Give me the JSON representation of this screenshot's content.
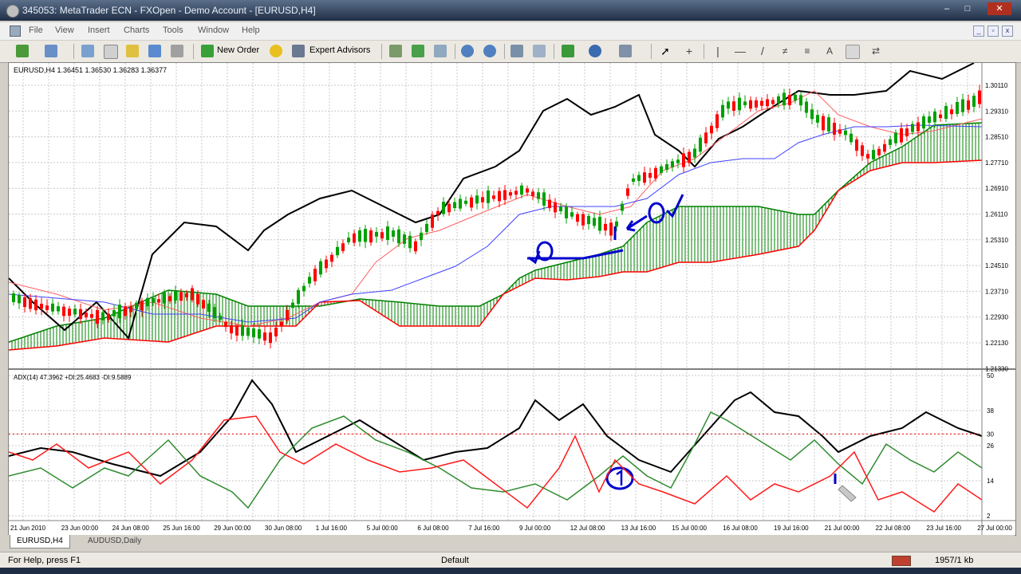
{
  "window": {
    "title": "345053: MetaTrader ECN - FXOpen - Demo Account - [EURUSD,H4]",
    "controls": {
      "minimize": "–",
      "maximize": "□",
      "close": "✕"
    }
  },
  "menu": {
    "items": [
      "File",
      "View",
      "Insert",
      "Charts",
      "Tools",
      "Window",
      "Help"
    ],
    "mdi": {
      "minimize": "_",
      "restore": "▫",
      "close": "x"
    }
  },
  "toolbar": {
    "new_order_label": "New Order",
    "expert_advisors_label": "Expert Advisors",
    "text_tool_label": "A"
  },
  "main_chart": {
    "header": "EURUSD,H4  1.36451  1.36530  1.36283  1.36377",
    "price_ticks": [
      "1.30110",
      "1.29310",
      "1.28510",
      "1.27710",
      "1.26910",
      "1.26110",
      "1.25310",
      "1.24510",
      "1.23710",
      "1.22930",
      "1.22130",
      "1.21330"
    ],
    "colors": {
      "bull": "#00a000",
      "bear": "#ff0000",
      "chikou": "#000000",
      "tenkan": "#ff6060",
      "kijun": "#4040ff",
      "cloud_up": "#008000",
      "cloud_down": "#ff0000",
      "annotation": "#0000cc"
    }
  },
  "indicator": {
    "header": "ADX(14) 47.3962  +DI:25.4683  -DI:9.5889",
    "ticks": [
      "50",
      "38",
      "30",
      "26",
      "14",
      "2"
    ],
    "level": 30
  },
  "time_axis": [
    "21 Jun 2010",
    "23 Jun 00:00",
    "24 Jun 08:00",
    "25 Jun 16:00",
    "29 Jun 00:00",
    "30 Jun 08:00",
    "1 Jul 16:00",
    "5 Jul 00:00",
    "6 Jul 08:00",
    "7 Jul 16:00",
    "9 Jul 00:00",
    "12 Jul 08:00",
    "13 Jul 16:00",
    "15 Jul 00:00",
    "16 Jul 08:00",
    "19 Jul 16:00",
    "21 Jul 00:00",
    "22 Jul 08:00",
    "23 Jul 16:00",
    "27 Jul 00:00"
  ],
  "chart_tabs": [
    "EURUSD,H4",
    "AUDUSD,Daily"
  ],
  "status": {
    "help": "For Help, press F1",
    "profile": "Default",
    "traffic": "1957/1 kb"
  }
}
